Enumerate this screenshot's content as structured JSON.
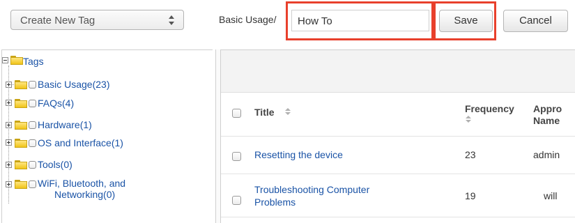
{
  "toolbar": {
    "tag_select_value": "Create New Tag",
    "path_prefix": "Basic Usage/",
    "tag_name_value": "How To",
    "save_label": "Save",
    "cancel_label": "Cancel",
    "highlight_color": "#e8402c"
  },
  "tree": {
    "root_label": "Tags",
    "items": [
      {
        "label": "Basic Usage(23)"
      },
      {
        "label": "FAQs(4)"
      },
      {
        "label": "Hardware(1)"
      },
      {
        "label": "OS and Interface(1)"
      },
      {
        "label": "Tools(0)"
      },
      {
        "label_line1": "WiFi, Bluetooth, and",
        "label_line2": "Networking(0)"
      }
    ]
  },
  "table": {
    "columns": {
      "title": "Title",
      "frequency": "Frequency",
      "approver_line1": "Appro",
      "approver_line2": "Name"
    },
    "rows": [
      {
        "title": "Resetting the device",
        "frequency": "23",
        "approver": "admin"
      },
      {
        "title_line1": "Troubleshooting Computer",
        "title_line2": "Problems",
        "frequency": "19",
        "approver": "will"
      }
    ]
  },
  "colors": {
    "link": "#1a53a6",
    "folder": "#f0c419"
  }
}
